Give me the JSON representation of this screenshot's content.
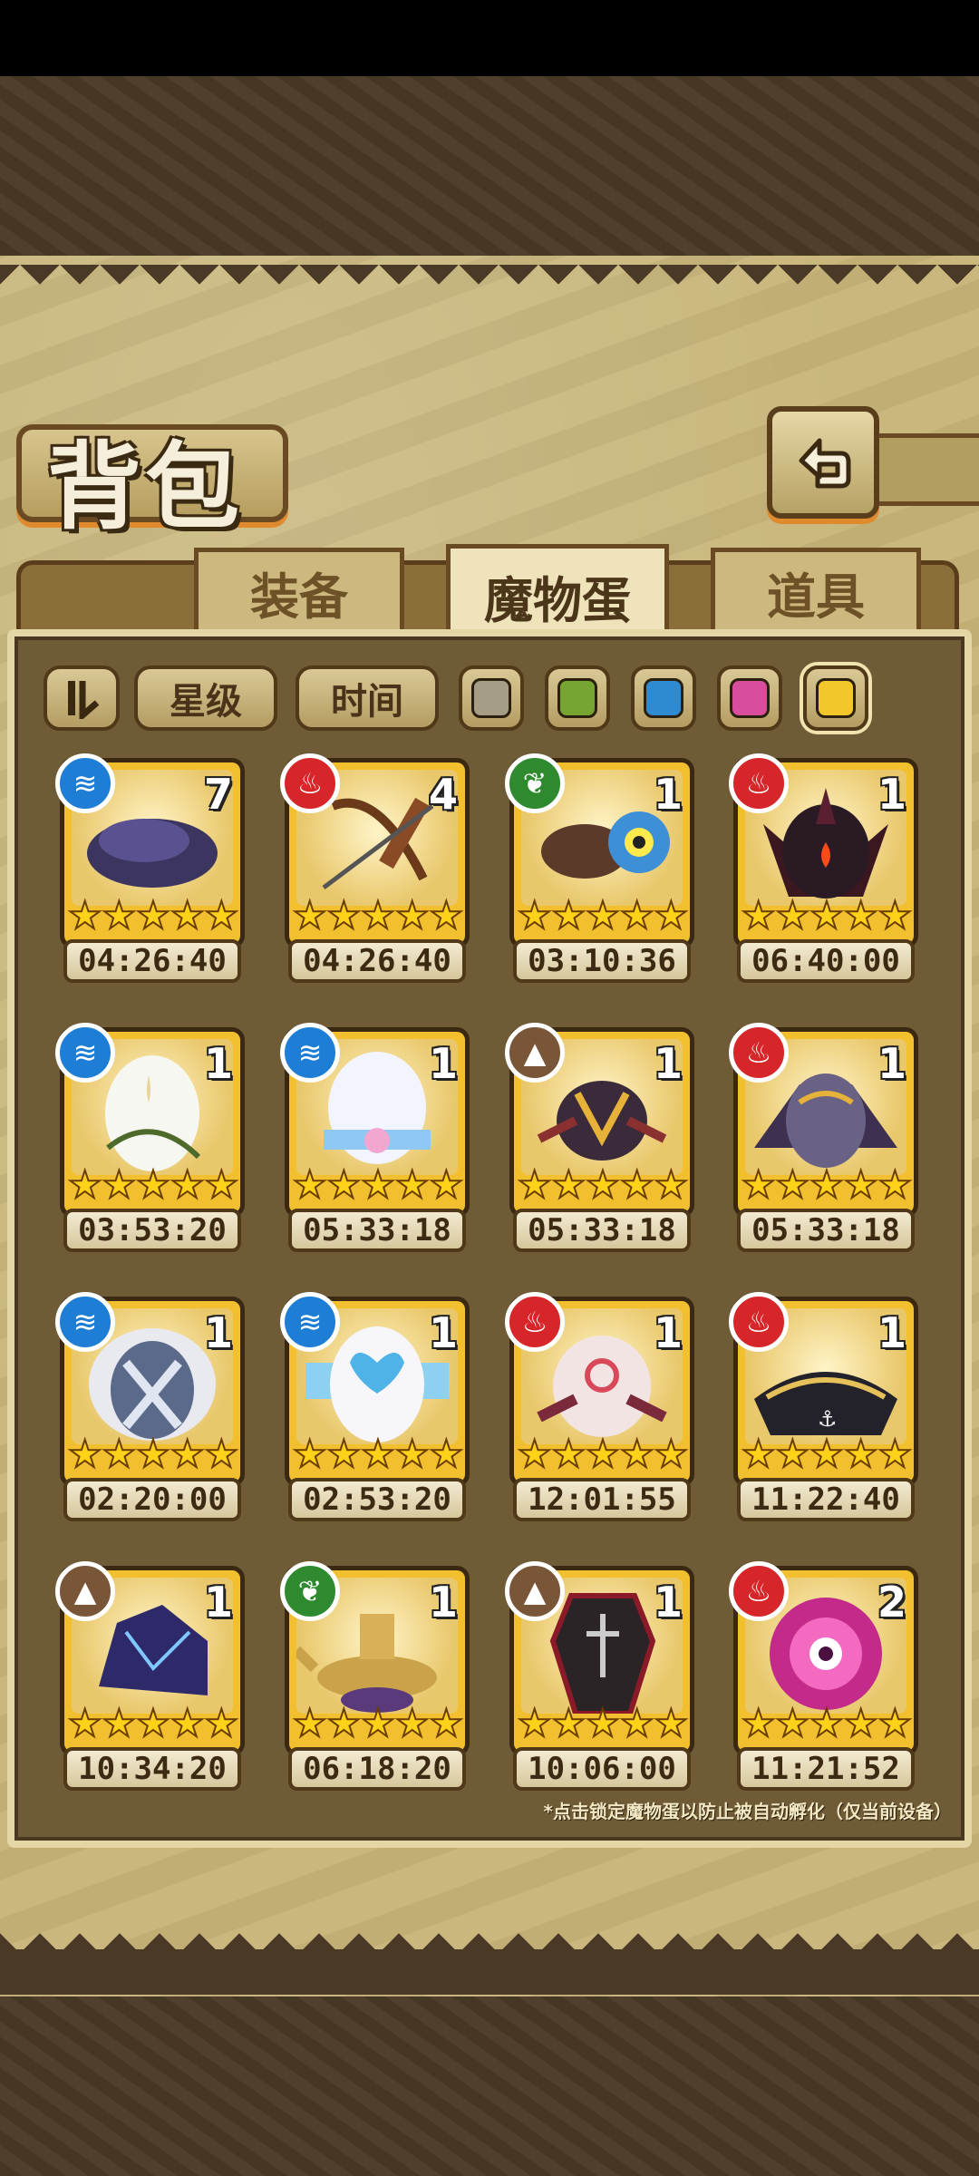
{
  "page": {
    "title": "背包"
  },
  "tabs": [
    {
      "label": "装备",
      "active": false
    },
    {
      "label": "魔物蛋",
      "active": true
    },
    {
      "label": "道具",
      "active": false
    }
  ],
  "filters": {
    "sort_icon": "sort-toggle-icon",
    "star_label": "星级",
    "time_label": "时间",
    "colors": [
      "#a59d86",
      "#76a532",
      "#2f8bd1",
      "#d94e9c",
      "#f3c62a"
    ]
  },
  "element_colors": {
    "water": "#1e7ed6",
    "fire": "#d7262a",
    "nature": "#2f8a2f",
    "earth": "#7a5638"
  },
  "eggs": [
    {
      "element": "water",
      "count": "7",
      "stars": 5,
      "time": "04:26:40",
      "art": "dark-feather"
    },
    {
      "element": "fire",
      "count": "4",
      "stars": 5,
      "time": "04:26:40",
      "art": "bow-quiver"
    },
    {
      "element": "nature",
      "count": "1",
      "stars": 5,
      "time": "03:10:36",
      "art": "blue-eye-creature"
    },
    {
      "element": "fire",
      "count": "1",
      "stars": 5,
      "time": "06:40:00",
      "art": "demon-wing"
    },
    {
      "element": "water",
      "count": "1",
      "stars": 5,
      "time": "03:53:20",
      "art": "white-vine-egg"
    },
    {
      "element": "water",
      "count": "1",
      "stars": 5,
      "time": "05:33:18",
      "art": "white-bow-egg"
    },
    {
      "element": "earth",
      "count": "1",
      "stars": 5,
      "time": "05:33:18",
      "art": "horned-bug"
    },
    {
      "element": "fire",
      "count": "1",
      "stars": 5,
      "time": "05:33:18",
      "art": "bat-egg"
    },
    {
      "element": "water",
      "count": "1",
      "stars": 5,
      "time": "02:20:00",
      "art": "frill-egg"
    },
    {
      "element": "water",
      "count": "1",
      "stars": 5,
      "time": "02:53:20",
      "art": "heart-egg"
    },
    {
      "element": "fire",
      "count": "1",
      "stars": 5,
      "time": "12:01:55",
      "art": "swirl-egg"
    },
    {
      "element": "fire",
      "count": "1",
      "stars": 5,
      "time": "11:22:40",
      "art": "pirate-hat"
    },
    {
      "element": "earth",
      "count": "1",
      "stars": 5,
      "time": "10:34:20",
      "art": "crystal-rock"
    },
    {
      "element": "nature",
      "count": "1",
      "stars": 5,
      "time": "06:18:20",
      "art": "magic-lamp"
    },
    {
      "element": "earth",
      "count": "1",
      "stars": 5,
      "time": "10:06:00",
      "art": "coffin"
    },
    {
      "element": "fire",
      "count": "2",
      "stars": 5,
      "time": "11:21:52",
      "art": "pink-orb"
    }
  ],
  "hint": "*点击锁定魔物蛋以防止被自动孵化（仅当前设备）"
}
